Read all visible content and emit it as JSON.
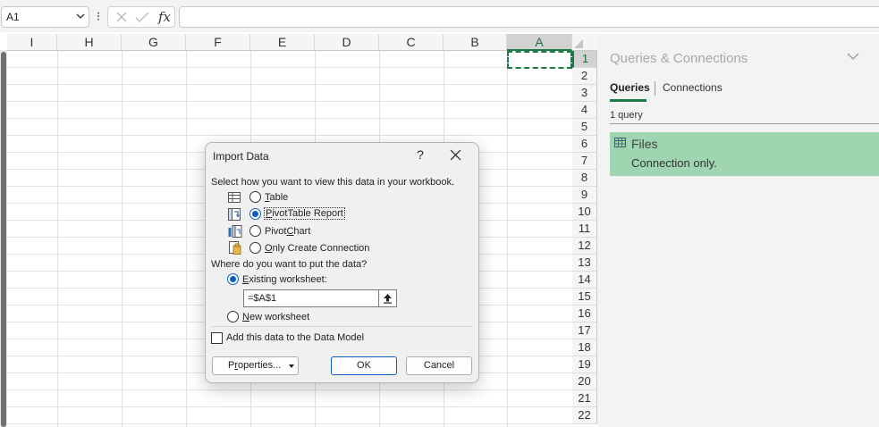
{
  "formula_bar": {
    "name_box": "A1",
    "menu_dots": "⁝",
    "fx_label": "fx",
    "formula": ""
  },
  "grid": {
    "columns": [
      "I",
      "H",
      "G",
      "F",
      "E",
      "D",
      "C",
      "B",
      "A"
    ],
    "rows": [
      "1",
      "2",
      "3",
      "4",
      "5",
      "6",
      "7",
      "8",
      "9",
      "10",
      "11",
      "12",
      "13",
      "14",
      "15",
      "16",
      "17",
      "18",
      "19",
      "20",
      "21",
      "22"
    ],
    "selected_cell": "A1"
  },
  "queries_pane": {
    "title": "Queries & Connections",
    "tabs": [
      "Queries",
      "Connections"
    ],
    "active_tab": "Queries",
    "count_text": "1 query",
    "items": [
      {
        "name": "Files",
        "status": "Connection only."
      }
    ],
    "selected_color": "#9fd5b0"
  },
  "dialog": {
    "title": "Import Data",
    "help": "?",
    "view_prompt": "Select how you want to view this data in your workbook.",
    "view_options": {
      "table": {
        "pre": "",
        "key": "T",
        "post": "able"
      },
      "pivottable": {
        "pre": "",
        "key": "P",
        "post": "ivotTable Report"
      },
      "pivotchart": {
        "pre": "Pivot",
        "key": "C",
        "post": "hart"
      },
      "connection": {
        "pre": "",
        "key": "O",
        "post": "nly Create Connection"
      }
    },
    "selected_view": "PivotTable Report",
    "location_prompt": "Where do you want to put the data?",
    "location_options": {
      "existing": {
        "pre": "",
        "key": "E",
        "post": "xisting worksheet:"
      },
      "new": {
        "pre": "",
        "key": "N",
        "post": "ew worksheet"
      }
    },
    "selected_location": "Existing worksheet:",
    "range_value": "=$A$1",
    "data_model_label": "Add this data to the Data Model",
    "data_model_checked": false,
    "properties_button": {
      "pre": "P",
      "key": "r",
      "post": "operties..."
    },
    "ok_button": "OK",
    "cancel_button": "Cancel"
  },
  "colors": {
    "accent_green": "#1f7a45",
    "radio_blue": "#0f5fc2"
  }
}
